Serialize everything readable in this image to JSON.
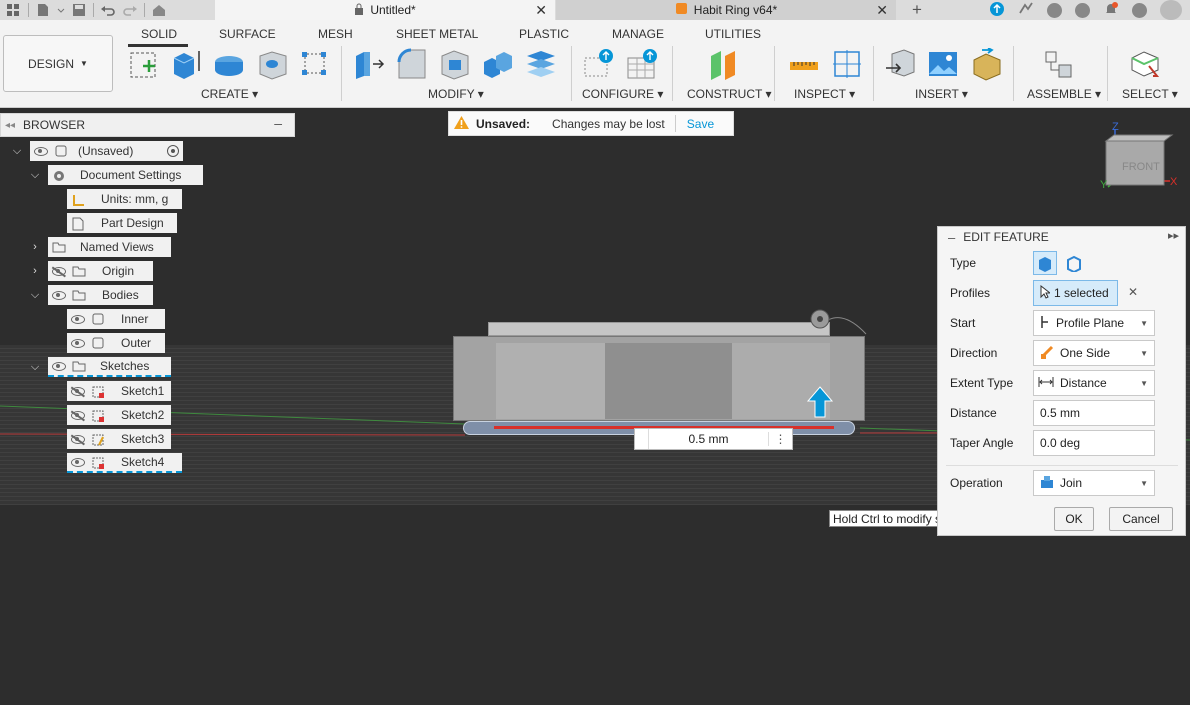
{
  "tabs": {
    "untitled": "Untitled*",
    "habit_ring": "Habit Ring v64*"
  },
  "toolbar": {
    "design": "DESIGN",
    "tabs": [
      "SOLID",
      "SURFACE",
      "MESH",
      "SHEET METAL",
      "PLASTIC",
      "MANAGE",
      "UTILITIES"
    ],
    "groups": [
      "CREATE",
      "MODIFY",
      "CONFIGURE",
      "CONSTRUCT",
      "INSPECT",
      "INSERT",
      "ASSEMBLE",
      "SELECT"
    ]
  },
  "browser": {
    "title": "BROWSER",
    "items": [
      {
        "label": "(Unsaved)"
      },
      {
        "label": "Document Settings"
      },
      {
        "label": "Units: mm, g"
      },
      {
        "label": "Part Design"
      },
      {
        "label": "Named Views"
      },
      {
        "label": "Origin"
      },
      {
        "label": "Bodies"
      },
      {
        "label": "Inner"
      },
      {
        "label": "Outer"
      },
      {
        "label": "Sketches"
      },
      {
        "label": "Sketch1"
      },
      {
        "label": "Sketch2"
      },
      {
        "label": "Sketch3"
      },
      {
        "label": "Sketch4"
      }
    ]
  },
  "unsaved": {
    "label": "Unsaved:",
    "message": "Changes may be lost",
    "save": "Save"
  },
  "viewport": {
    "distance_value": "0.5 mm",
    "tooltip": "Hold Ctrl to modify selection",
    "viewcube_face": "FRONT",
    "axis_z": "Z",
    "axis_x": "X",
    "axis_y": "Y"
  },
  "edit_feature": {
    "title": "EDIT FEATURE",
    "type_label": "Type",
    "profiles_label": "Profiles",
    "profiles_value": "1 selected",
    "start_label": "Start",
    "start_value": "Profile Plane",
    "direction_label": "Direction",
    "direction_value": "One Side",
    "extent_label": "Extent Type",
    "extent_value": "Distance",
    "distance_label": "Distance",
    "distance_value": "0.5 mm",
    "taper_label": "Taper Angle",
    "taper_value": "0.0 deg",
    "operation_label": "Operation",
    "operation_value": "Join",
    "ok": "OK",
    "cancel": "Cancel"
  },
  "colors": {
    "accent": "#0696d7",
    "panel_bg": "#f5f5f5",
    "viewport_bg": "#2d2d2d",
    "warning": "#f0a01c"
  }
}
